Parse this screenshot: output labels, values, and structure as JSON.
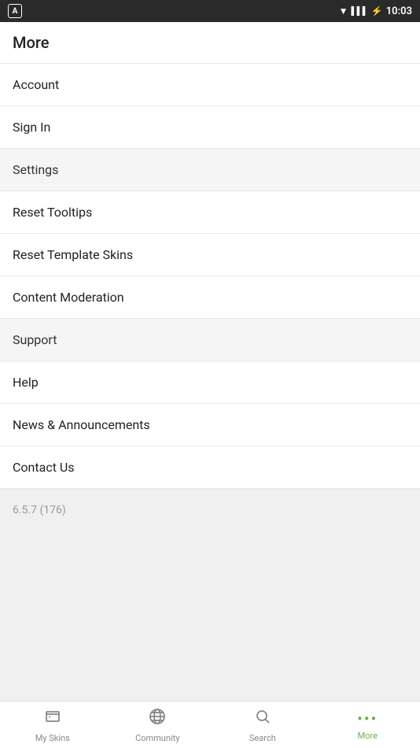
{
  "statusBar": {
    "time": "10:03"
  },
  "pageTitle": "More",
  "menuItems": [
    {
      "id": "account",
      "label": "Account",
      "type": "normal"
    },
    {
      "id": "sign-in",
      "label": "Sign In",
      "type": "normal"
    },
    {
      "id": "settings",
      "label": "Settings",
      "type": "section"
    },
    {
      "id": "reset-tooltips",
      "label": "Reset Tooltips",
      "type": "normal"
    },
    {
      "id": "reset-template-skins",
      "label": "Reset Template Skins",
      "type": "normal"
    },
    {
      "id": "content-moderation",
      "label": "Content Moderation",
      "type": "normal"
    },
    {
      "id": "support",
      "label": "Support",
      "type": "section"
    },
    {
      "id": "help",
      "label": "Help",
      "type": "normal"
    },
    {
      "id": "news-announcements",
      "label": "News & Announcements",
      "type": "normal"
    },
    {
      "id": "contact-us",
      "label": "Contact Us",
      "type": "normal"
    }
  ],
  "versionText": "6.5.7 (176)",
  "bottomNav": {
    "items": [
      {
        "id": "my-skins",
        "label": "My Skins",
        "active": false
      },
      {
        "id": "community",
        "label": "Community",
        "active": false
      },
      {
        "id": "search",
        "label": "Search",
        "active": false
      },
      {
        "id": "more",
        "label": "More",
        "active": true
      }
    ]
  }
}
